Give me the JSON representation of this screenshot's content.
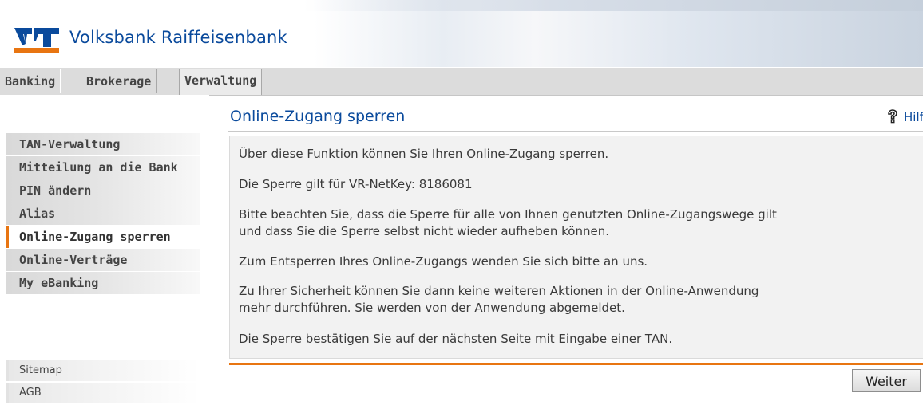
{
  "header": {
    "bank_name": "Volksbank Raiffeisenbank",
    "logo_icon": "vr-logo-icon",
    "brand_blue": "#0a4a9c",
    "brand_orange": "#e87511"
  },
  "tabs": [
    {
      "label": "Banking",
      "active": false
    },
    {
      "label": "Brokerage",
      "active": false
    },
    {
      "label": "Verwaltung",
      "active": true
    }
  ],
  "sidebar": {
    "items": [
      {
        "label": "TAN-Verwaltung",
        "active": false
      },
      {
        "label": "Mitteilung an die Bank",
        "active": false
      },
      {
        "label": "PIN ändern",
        "active": false
      },
      {
        "label": "Alias",
        "active": false
      },
      {
        "label": "Online-Zugang sperren",
        "active": true
      },
      {
        "label": "Online-Verträge",
        "active": false
      },
      {
        "label": "My eBanking",
        "active": false
      }
    ],
    "footer_links": [
      {
        "label": "Sitemap"
      },
      {
        "label": "AGB"
      }
    ]
  },
  "main": {
    "title": "Online-Zugang sperren",
    "help_label": "Hilfe",
    "help_icon": "help-question-icon",
    "paragraphs": [
      "Über diese Funktion können Sie Ihren Online-Zugang sperren.",
      "Die Sperre gilt für VR-NetKey: 8186081",
      "Bitte beachten Sie, dass die Sperre für alle von Ihnen genutzten Online-Zugangswege gilt",
      "und dass Sie die Sperre selbst nicht wieder aufheben können.",
      "Zum Entsperren Ihres Online-Zugangs wenden Sie sich bitte an uns.",
      "Zu Ihrer Sicherheit können Sie dann keine weiteren Aktionen in der Online-Anwendung",
      "mehr durchführen. Sie werden von der Anwendung abgemeldet.",
      "Die Sperre bestätigen Sie auf der nächsten Seite mit Eingabe einer TAN."
    ],
    "next_button": "Weiter"
  }
}
